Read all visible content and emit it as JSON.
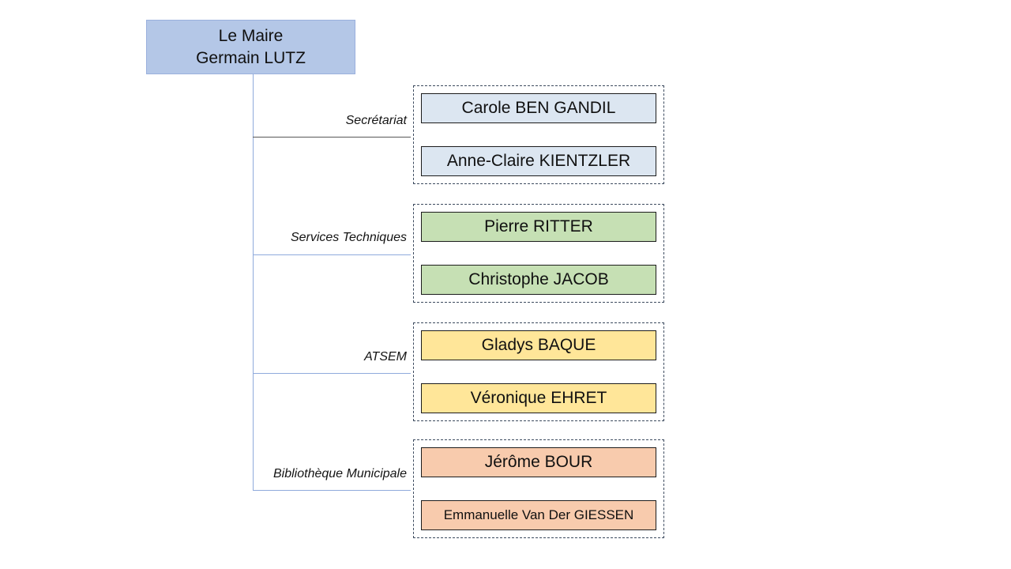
{
  "chart": {
    "type": "org-chart",
    "root": {
      "title": "Le Maire",
      "name": "Germain LUTZ",
      "fill": "#b4c7e7"
    },
    "groups": [
      {
        "label": "Secrétariat",
        "fill": "#dce6f1",
        "members": [
          {
            "name": "Carole BEN GANDIL"
          },
          {
            "name": "Anne-Claire KIENTZLER"
          }
        ]
      },
      {
        "label": "Services Techniques",
        "fill": "#c6e0b4",
        "members": [
          {
            "name": "Pierre RITTER"
          },
          {
            "name": "Christophe JACOB"
          }
        ]
      },
      {
        "label": "ATSEM",
        "fill": "#ffe699",
        "members": [
          {
            "name": "Gladys BAQUE"
          },
          {
            "name": "Véronique EHRET"
          }
        ]
      },
      {
        "label": "Bibliothèque Municipale",
        "fill": "#f8cbad",
        "members": [
          {
            "name": "Jérôme BOUR"
          },
          {
            "name": "Emmanuelle Van Der GIESSEN"
          }
        ]
      }
    ]
  }
}
